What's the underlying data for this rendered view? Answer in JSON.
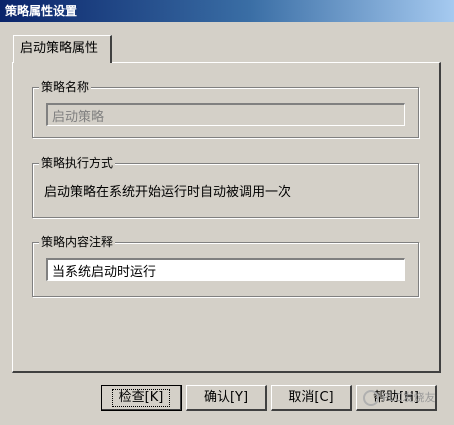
{
  "window": {
    "title": "策略属性设置"
  },
  "tab": {
    "label": "启动策略属性"
  },
  "groups": {
    "name": {
      "label": "策略名称",
      "value": "启动策略"
    },
    "execution": {
      "label": "策略执行方式",
      "text": "启动策略在系统开始运行时自动被调用一次"
    },
    "comment": {
      "label": "策略内容注释",
      "value": "当系统启动时运行"
    }
  },
  "buttons": {
    "check": "检查[K]",
    "ok": "确认[Y]",
    "cancel": "取消[C]",
    "help": "帮助[H]"
  },
  "watermark": {
    "text": "PLC发烧友",
    "icon": "wechat-icon"
  }
}
